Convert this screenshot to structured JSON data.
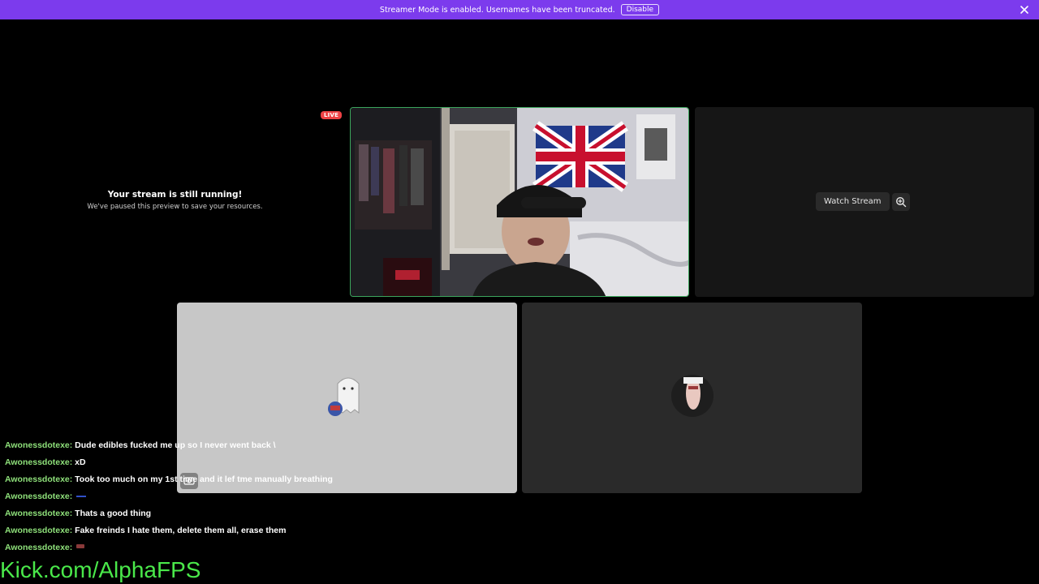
{
  "banner": {
    "message": "Streamer Mode is enabled. Usernames have been truncated.",
    "disable_label": "Disable",
    "close_icon": "close-icon"
  },
  "paused_preview": {
    "title": "Your stream is still running!",
    "subtitle": "We've paused this preview to save your resources."
  },
  "live_badge": "LIVE",
  "tiles": {
    "watch_stream_label": "Watch Stream",
    "watch_icon": "zoom-plus-icon"
  },
  "chat": [
    {
      "user": "Awonessdotexe:",
      "message": "Dude edibles fucked me up so I never went back \\"
    },
    {
      "user": "Awonessdotexe:",
      "message": "xD"
    },
    {
      "user": "Awonessdotexe:",
      "message": "Took too much on my 1st time and it lef tme manually breathing"
    },
    {
      "user": "Awonessdotexe:",
      "message": "",
      "emote": "small-emote-icon"
    },
    {
      "user": "Awonessdotexe:",
      "message": "Thats a good thing"
    },
    {
      "user": "Awonessdotexe:",
      "message": "Fake freinds I hate them, delete them all, erase them"
    },
    {
      "user": "Awonessdotexe:",
      "message": "",
      "emote": "small-emote-icon"
    }
  ],
  "overlay_link": "Kick.com/AlphaFPS",
  "colors": {
    "banner": "#7c3bed",
    "live": "#ed4245",
    "speaking_border": "#3ba55c",
    "chat_user": "#8ee07a",
    "kick_link": "#4ae84a"
  }
}
